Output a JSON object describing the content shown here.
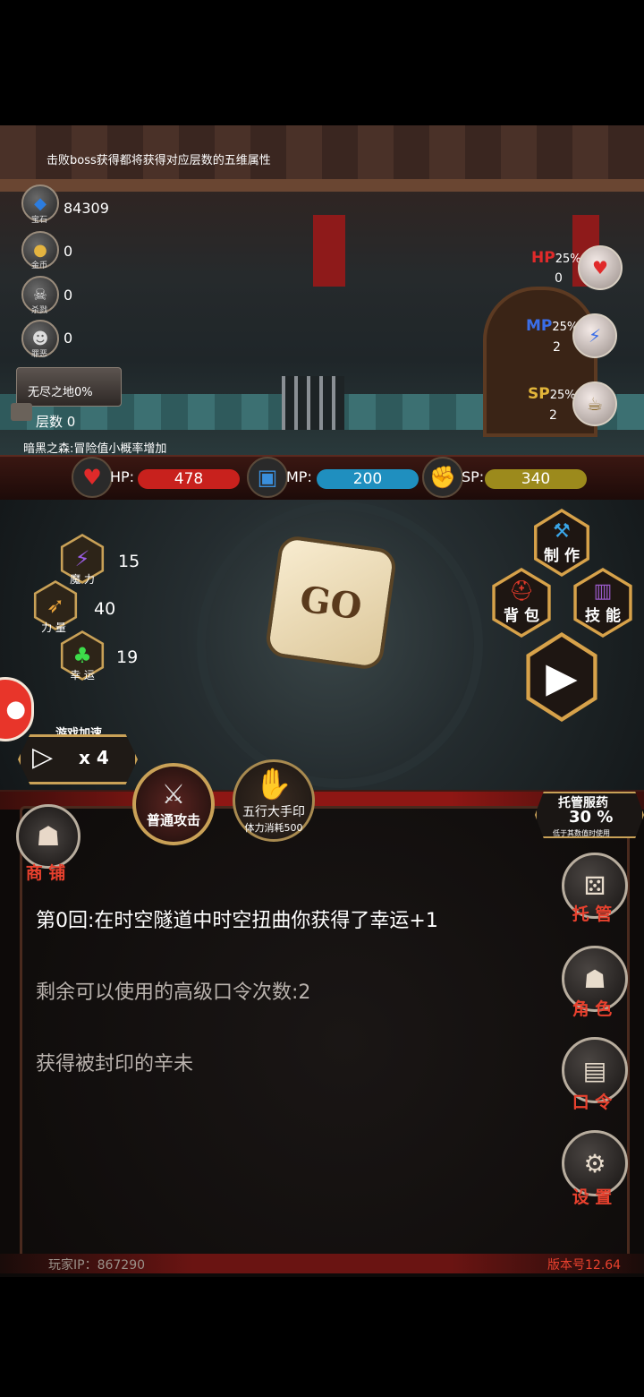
{
  "top_tip": "击败boss获得都将获得对应层数的五维属性",
  "resources": [
    {
      "icon": "gem-icon",
      "glyph": "◆",
      "sub": "宝石",
      "value": "84309"
    },
    {
      "icon": "coin-icon",
      "glyph": "●",
      "sub": "金币",
      "value": "0"
    },
    {
      "icon": "skull-icon",
      "glyph": "☠",
      "sub": "杀戮",
      "value": "0"
    },
    {
      "icon": "mask-icon",
      "glyph": "☻",
      "sub": "罪恶",
      "value": "0"
    }
  ],
  "dungeon": {
    "name": "无尽之地0%",
    "floor": "层数 0"
  },
  "dark_forest_tip": "暗黑之森:冒险值小概率增加",
  "potions": [
    {
      "label": "HP",
      "pct": "25%",
      "count": "0",
      "color": "#e02a2a",
      "glyph": "♥"
    },
    {
      "label": "MP",
      "pct": "25%",
      "count": "2",
      "color": "#3a6ee8",
      "glyph": "⚡"
    },
    {
      "label": "SP",
      "pct": "25%",
      "count": "2",
      "color": "#e3b63a",
      "glyph": "☕"
    }
  ],
  "stats": {
    "hp": {
      "label": "HP:",
      "value": "478",
      "color": "#c8211d",
      "fill": 1.0
    },
    "mp": {
      "label": "MP:",
      "value": "200",
      "color": "#1f8fbf",
      "fill": 1.0
    },
    "sp": {
      "label": "SP:",
      "value": "340",
      "color": "#9c8a1c",
      "fill": 1.0
    }
  },
  "attributes": [
    {
      "name": "魔 力",
      "value": "15",
      "glyph": "⚡",
      "color": "#9b5de5"
    },
    {
      "name": "力 量",
      "value": "40",
      "glyph": "➶",
      "color": "#e8a23a"
    },
    {
      "name": "幸 运",
      "value": "19",
      "glyph": "♣",
      "color": "#3ddc4a"
    }
  ],
  "dice_label": "GO",
  "menu": {
    "craft": "制 作",
    "bag": "背 包",
    "skill": "技 能"
  },
  "speed": {
    "title": "游戏加速",
    "value": "x 4"
  },
  "skills": {
    "attack": "普通攻击",
    "seal": "五行大手印",
    "seal_cost": "体力消耗500"
  },
  "shop_label": "商 铺",
  "auto_potion": {
    "title": "托管服药",
    "pct": "30 %",
    "sub": "低于其数值时使用"
  },
  "log": [
    {
      "text": "第0回:在时空隧道中时空扭曲你获得了幸运+1",
      "color": "#ffffff"
    },
    {
      "text": "剩余可以使用的高级口令次数:2",
      "color": "#b9b2ad"
    },
    {
      "text": "获得被封印的辛未",
      "color": "#b9b2ad"
    }
  ],
  "side_buttons": [
    {
      "name": "auto-button",
      "label": "托 管",
      "icon": "dice-icon",
      "glyph": "⚄"
    },
    {
      "name": "character-button",
      "label": "角 色",
      "icon": "hood-icon",
      "glyph": "☗"
    },
    {
      "name": "password-button",
      "label": "口 令",
      "icon": "book-icon",
      "glyph": "▤"
    },
    {
      "name": "settings-button",
      "label": "设 置",
      "icon": "gear-icon",
      "glyph": "⚙"
    }
  ],
  "footer": {
    "player_ip": "玩家IP：867290",
    "version": "版本号12.64"
  }
}
